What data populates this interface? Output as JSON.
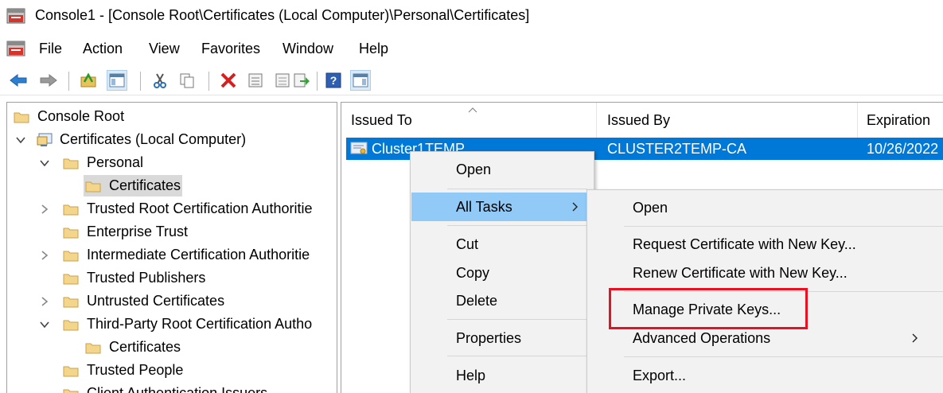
{
  "window": {
    "title": "Console1 - [Console Root\\Certificates (Local Computer)\\Personal\\Certificates]"
  },
  "menubar": {
    "items": [
      "File",
      "Action",
      "View",
      "Favorites",
      "Window",
      "Help"
    ]
  },
  "toolbar": {
    "buttons": [
      "back-icon",
      "forward-icon",
      "up-folder-icon",
      "show-hide-tree-icon",
      "cut-icon",
      "copy-icon",
      "delete-icon",
      "properties-icon",
      "refresh-icon",
      "export-list-icon",
      "help-icon",
      "action-pane-icon"
    ]
  },
  "tree": {
    "nodes": [
      {
        "label": "Console Root"
      },
      {
        "label": "Certificates (Local Computer)"
      },
      {
        "label": "Personal"
      },
      {
        "label": "Certificates"
      },
      {
        "label": "Trusted Root Certification Authoritie"
      },
      {
        "label": "Enterprise Trust"
      },
      {
        "label": "Intermediate Certification Authoritie"
      },
      {
        "label": "Trusted Publishers"
      },
      {
        "label": "Untrusted Certificates"
      },
      {
        "label": "Third-Party Root Certification Autho"
      },
      {
        "label": "Certificates"
      },
      {
        "label": "Trusted People"
      },
      {
        "label": "Client Authentication Issuers"
      }
    ]
  },
  "list": {
    "columns": [
      "Issued To",
      "Issued By",
      "Expiration"
    ],
    "rows": [
      {
        "issued_to": "Cluster1TEMP",
        "issued_by": "CLUSTER2TEMP-CA",
        "expiration": "10/26/2022"
      }
    ]
  },
  "context_menu": {
    "items": [
      "Open",
      "All Tasks",
      "Cut",
      "Copy",
      "Delete",
      "Properties",
      "Help"
    ]
  },
  "submenu": {
    "items": [
      "Open",
      "Request Certificate with New Key...",
      "Renew Certificate with New Key...",
      "Manage Private Keys...",
      "Advanced Operations",
      "Export..."
    ]
  },
  "colors": {
    "selection": "#0078d7",
    "menu_highlight": "#91c9f7",
    "annotation": "#e81123",
    "folder": "#f4d58c"
  }
}
